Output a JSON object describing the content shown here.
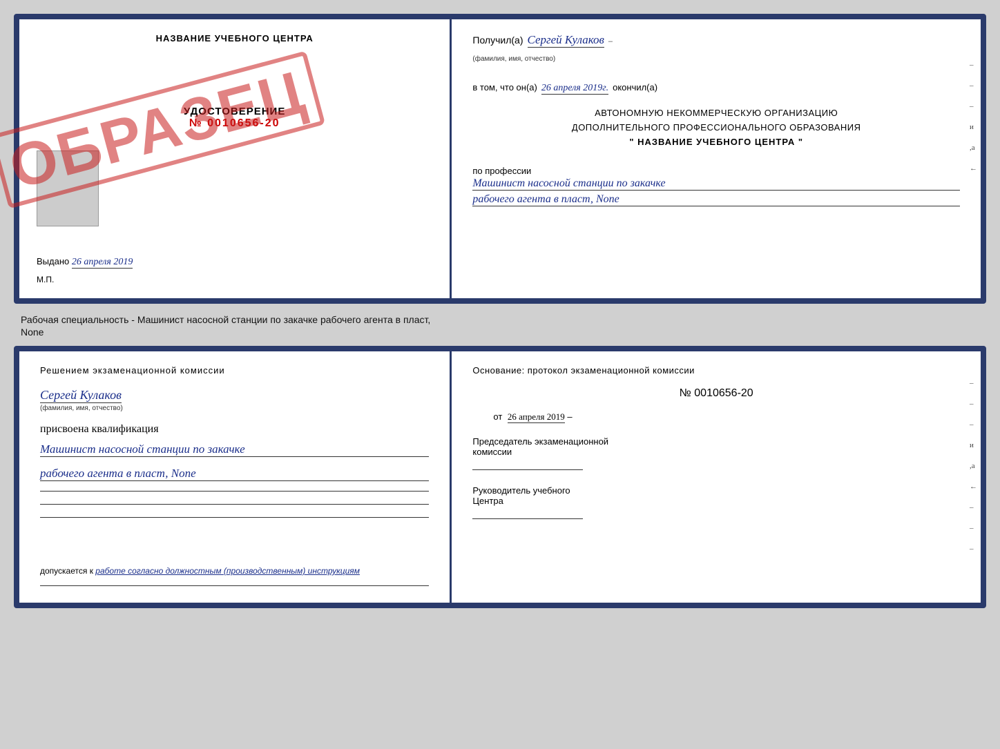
{
  "background_color": "#d0d0d0",
  "top_document": {
    "left": {
      "training_center_title": "НАЗВАНИЕ УЧЕБНОГО ЦЕНТРА",
      "obrazets_stamp": "ОБРАЗЕЦ",
      "udostoverenie_label": "УДОСТОВЕРЕНИЕ",
      "udostoverenie_number": "№ 0010656-20",
      "vydano_label": "Выдано",
      "vydano_date": "26 апреля 2019",
      "mp_label": "М.П."
    },
    "right": {
      "poluchil_prefix": "Получил(а)",
      "poluchil_name": "Сергей Кулаков",
      "familiya_hint": "(фамилия, имя, отчество)",
      "vtom_prefix": "в том, что он(а)",
      "vtom_date": "26 апреля 2019г.",
      "okonchil_label": "окончил(а)",
      "org_line1": "АВТОНОМНУЮ НЕКОММЕРЧЕСКУЮ ОРГАНИЗАЦИЮ",
      "org_line2": "ДОПОЛНИТЕЛЬНОГО ПРОФЕССИОНАЛЬНОГО ОБРАЗОВАНИЯ",
      "org_line3": "\"    НАЗВАНИЕ УЧЕБНОГО ЦЕНТРА    \"",
      "po_professii": "по профессии",
      "profession_line1": "Машинист насосной станции по закачке",
      "profession_line2": "рабочего агента в пласт, None",
      "right_side_marks": [
        "-",
        "-",
        "-",
        "и",
        ",а",
        "←"
      ]
    }
  },
  "caption": {
    "text": "Рабочая специальность - Машинист насосной станции по закачке рабочего агента в пласт,",
    "text2": "None"
  },
  "bottom_document": {
    "left": {
      "resheniem_text": "Решением  экзаменационной  комиссии",
      "name_handwritten": "Сергей Кулаков",
      "familiya_hint": "(фамилия, имя, отчество)",
      "prisvoena_text": "присвоена квалификация",
      "kvalif_line1": "Машинист насосной станции по закачке",
      "kvalif_line2": "рабочего агента в пласт, None",
      "dopuskaetsya_prefix": "допускается к",
      "dopuskaetsya_italic": "работе согласно должностным (производственным) инструкциям"
    },
    "right": {
      "osnovaniye_text": "Основание:  протокол  экзаменационной  комиссии",
      "protocol_number": "№  0010656-20",
      "ot_label": "от",
      "ot_date": "26 апреля 2019",
      "predsedatel_line1": "Председатель экзаменационной",
      "predsedatel_line2": "комиссии",
      "rukovoditel_line1": "Руководитель учебного",
      "rukovoditel_line2": "Центра",
      "right_side_marks": [
        "-",
        "-",
        "-",
        "и",
        ",а",
        "←",
        "-",
        "-",
        "-"
      ]
    }
  }
}
